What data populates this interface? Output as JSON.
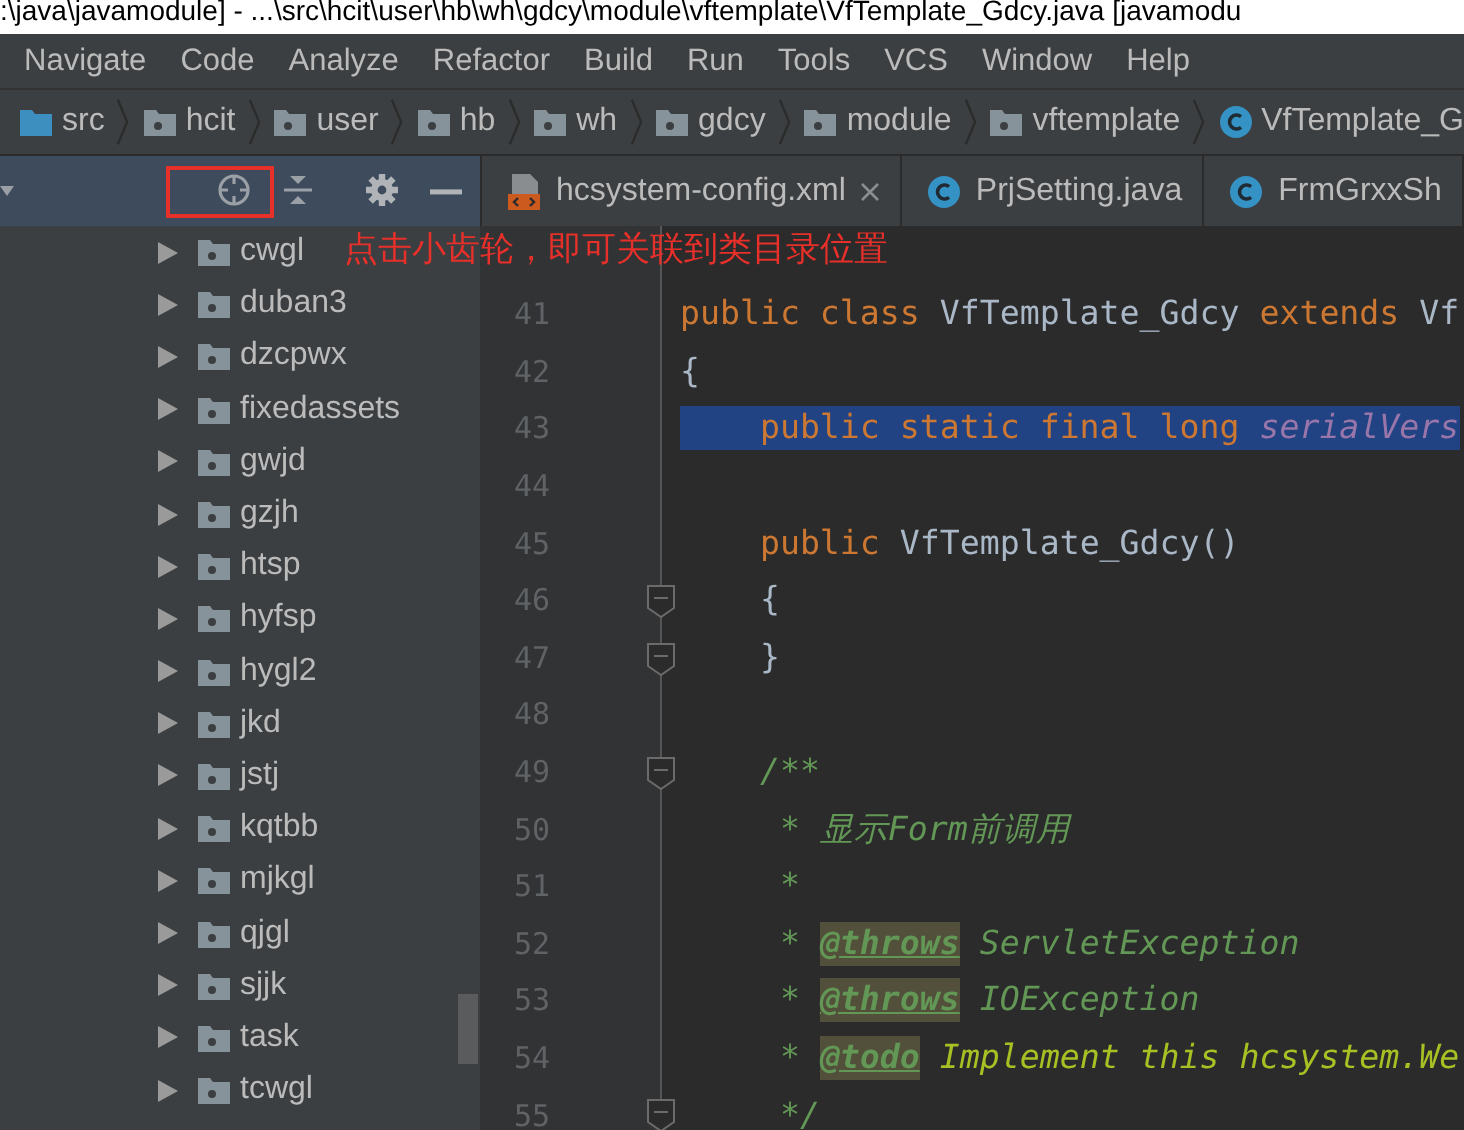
{
  "window": {
    "title": ":\\java\\javamodule] - ...\\src\\hcit\\user\\hb\\wh\\gdcy\\module\\vftemplate\\VfTemplate_Gdcy.java [javamodu"
  },
  "menu": [
    "Navigate",
    "Code",
    "Analyze",
    "Refactor",
    "Build",
    "Run",
    "Tools",
    "VCS",
    "Window",
    "Help"
  ],
  "breadcrumbs": [
    {
      "kind": "source",
      "label": "src"
    },
    {
      "kind": "package",
      "label": "hcit"
    },
    {
      "kind": "package",
      "label": "user"
    },
    {
      "kind": "package",
      "label": "hb"
    },
    {
      "kind": "package",
      "label": "wh"
    },
    {
      "kind": "package",
      "label": "gdcy"
    },
    {
      "kind": "package",
      "label": "module"
    },
    {
      "kind": "package",
      "label": "vftemplate"
    },
    {
      "kind": "class",
      "label": "VfTemplate_G"
    }
  ],
  "project_tree": {
    "items": [
      {
        "label": "cwgl",
        "expanded": false
      },
      {
        "label": "duban3",
        "expanded": false
      },
      {
        "label": "dzcpwx",
        "expanded": false
      },
      {
        "label": "fixedassets",
        "expanded": false
      },
      {
        "label": "gwjd",
        "expanded": false
      },
      {
        "label": "gzjh",
        "expanded": false
      },
      {
        "label": "htsp",
        "expanded": false
      },
      {
        "label": "hyfsp",
        "expanded": false
      },
      {
        "label": "hygl2",
        "expanded": false
      },
      {
        "label": "jkd",
        "expanded": false
      },
      {
        "label": "jstj",
        "expanded": false
      },
      {
        "label": "kqtbb",
        "expanded": false
      },
      {
        "label": "mjkgl",
        "expanded": false
      },
      {
        "label": "qjgl",
        "expanded": false
      },
      {
        "label": "sjjk",
        "expanded": false
      },
      {
        "label": "task",
        "expanded": false
      },
      {
        "label": "tcwgl",
        "expanded": false
      }
    ]
  },
  "annotation": {
    "text": "点击小齿轮，即可关联到类目录位置"
  },
  "editor_tabs": [
    {
      "kind": "xml",
      "label": "hcsystem-config.xml",
      "closable": true
    },
    {
      "kind": "class",
      "label": "PrjSetting.java",
      "closable": false
    },
    {
      "kind": "class",
      "label": "FrmGrxxSh",
      "closable": false
    }
  ],
  "code_lines": [
    {
      "number": "41",
      "fold": false,
      "selected": false,
      "tokens": [
        {
          "kind": "keyword",
          "text": "public class "
        },
        {
          "kind": "plain",
          "text": "VfTemplate_Gdcy"
        },
        {
          "kind": "keyword",
          "text": " extends "
        },
        {
          "kind": "plain",
          "text": "Vf"
        }
      ]
    },
    {
      "number": "42",
      "fold": false,
      "selected": false,
      "tokens": [
        {
          "kind": "plain",
          "text": "{"
        }
      ]
    },
    {
      "number": "43",
      "fold": false,
      "selected": true,
      "tokens": [
        {
          "kind": "keyword",
          "text": "    public static final long "
        },
        {
          "kind": "field",
          "text": "serialVers"
        }
      ]
    },
    {
      "number": "44",
      "fold": false,
      "selected": false
    },
    {
      "number": "45",
      "fold": false,
      "selected": false,
      "tokens": [
        {
          "kind": "keyword",
          "text": "    public "
        },
        {
          "kind": "plain",
          "text": "VfTemplate_Gdcy()"
        }
      ]
    },
    {
      "number": "46",
      "fold": true,
      "selected": false,
      "tokens": [
        {
          "kind": "plain",
          "text": "    {"
        }
      ]
    },
    {
      "number": "47",
      "fold": true,
      "selected": false,
      "tokens": [
        {
          "kind": "plain",
          "text": "    }"
        }
      ]
    },
    {
      "number": "48",
      "fold": false,
      "selected": false
    },
    {
      "number": "49",
      "fold": true,
      "selected": false,
      "tokens": [
        {
          "kind": "comment",
          "text": "    /**"
        }
      ]
    },
    {
      "number": "50",
      "fold": false,
      "selected": false,
      "tokens": [
        {
          "kind": "comment",
          "text": "     * 显示Form前调用"
        }
      ]
    },
    {
      "number": "51",
      "fold": false,
      "selected": false,
      "tokens": [
        {
          "kind": "comment",
          "text": "     *"
        }
      ]
    },
    {
      "number": "52",
      "fold": false,
      "selected": false,
      "tokens": [
        {
          "kind": "comment",
          "text": "     * "
        },
        {
          "kind": "doctag",
          "text": "@throws"
        },
        {
          "kind": "comment",
          "text": " ServletException"
        }
      ]
    },
    {
      "number": "53",
      "fold": false,
      "selected": false,
      "tokens": [
        {
          "kind": "comment",
          "text": "     * "
        },
        {
          "kind": "doctag",
          "text": "@throws"
        },
        {
          "kind": "comment",
          "text": " IOException"
        }
      ]
    },
    {
      "number": "54",
      "fold": false,
      "selected": false,
      "tokens": [
        {
          "kind": "comment",
          "text": "     * "
        },
        {
          "kind": "doctag",
          "text": "@todo"
        },
        {
          "kind": "todo",
          "text": " Implement this hcsystem.We"
        }
      ]
    },
    {
      "number": "55",
      "fold": true,
      "selected": false,
      "tokens": [
        {
          "kind": "comment",
          "text": "     */"
        }
      ]
    }
  ]
}
